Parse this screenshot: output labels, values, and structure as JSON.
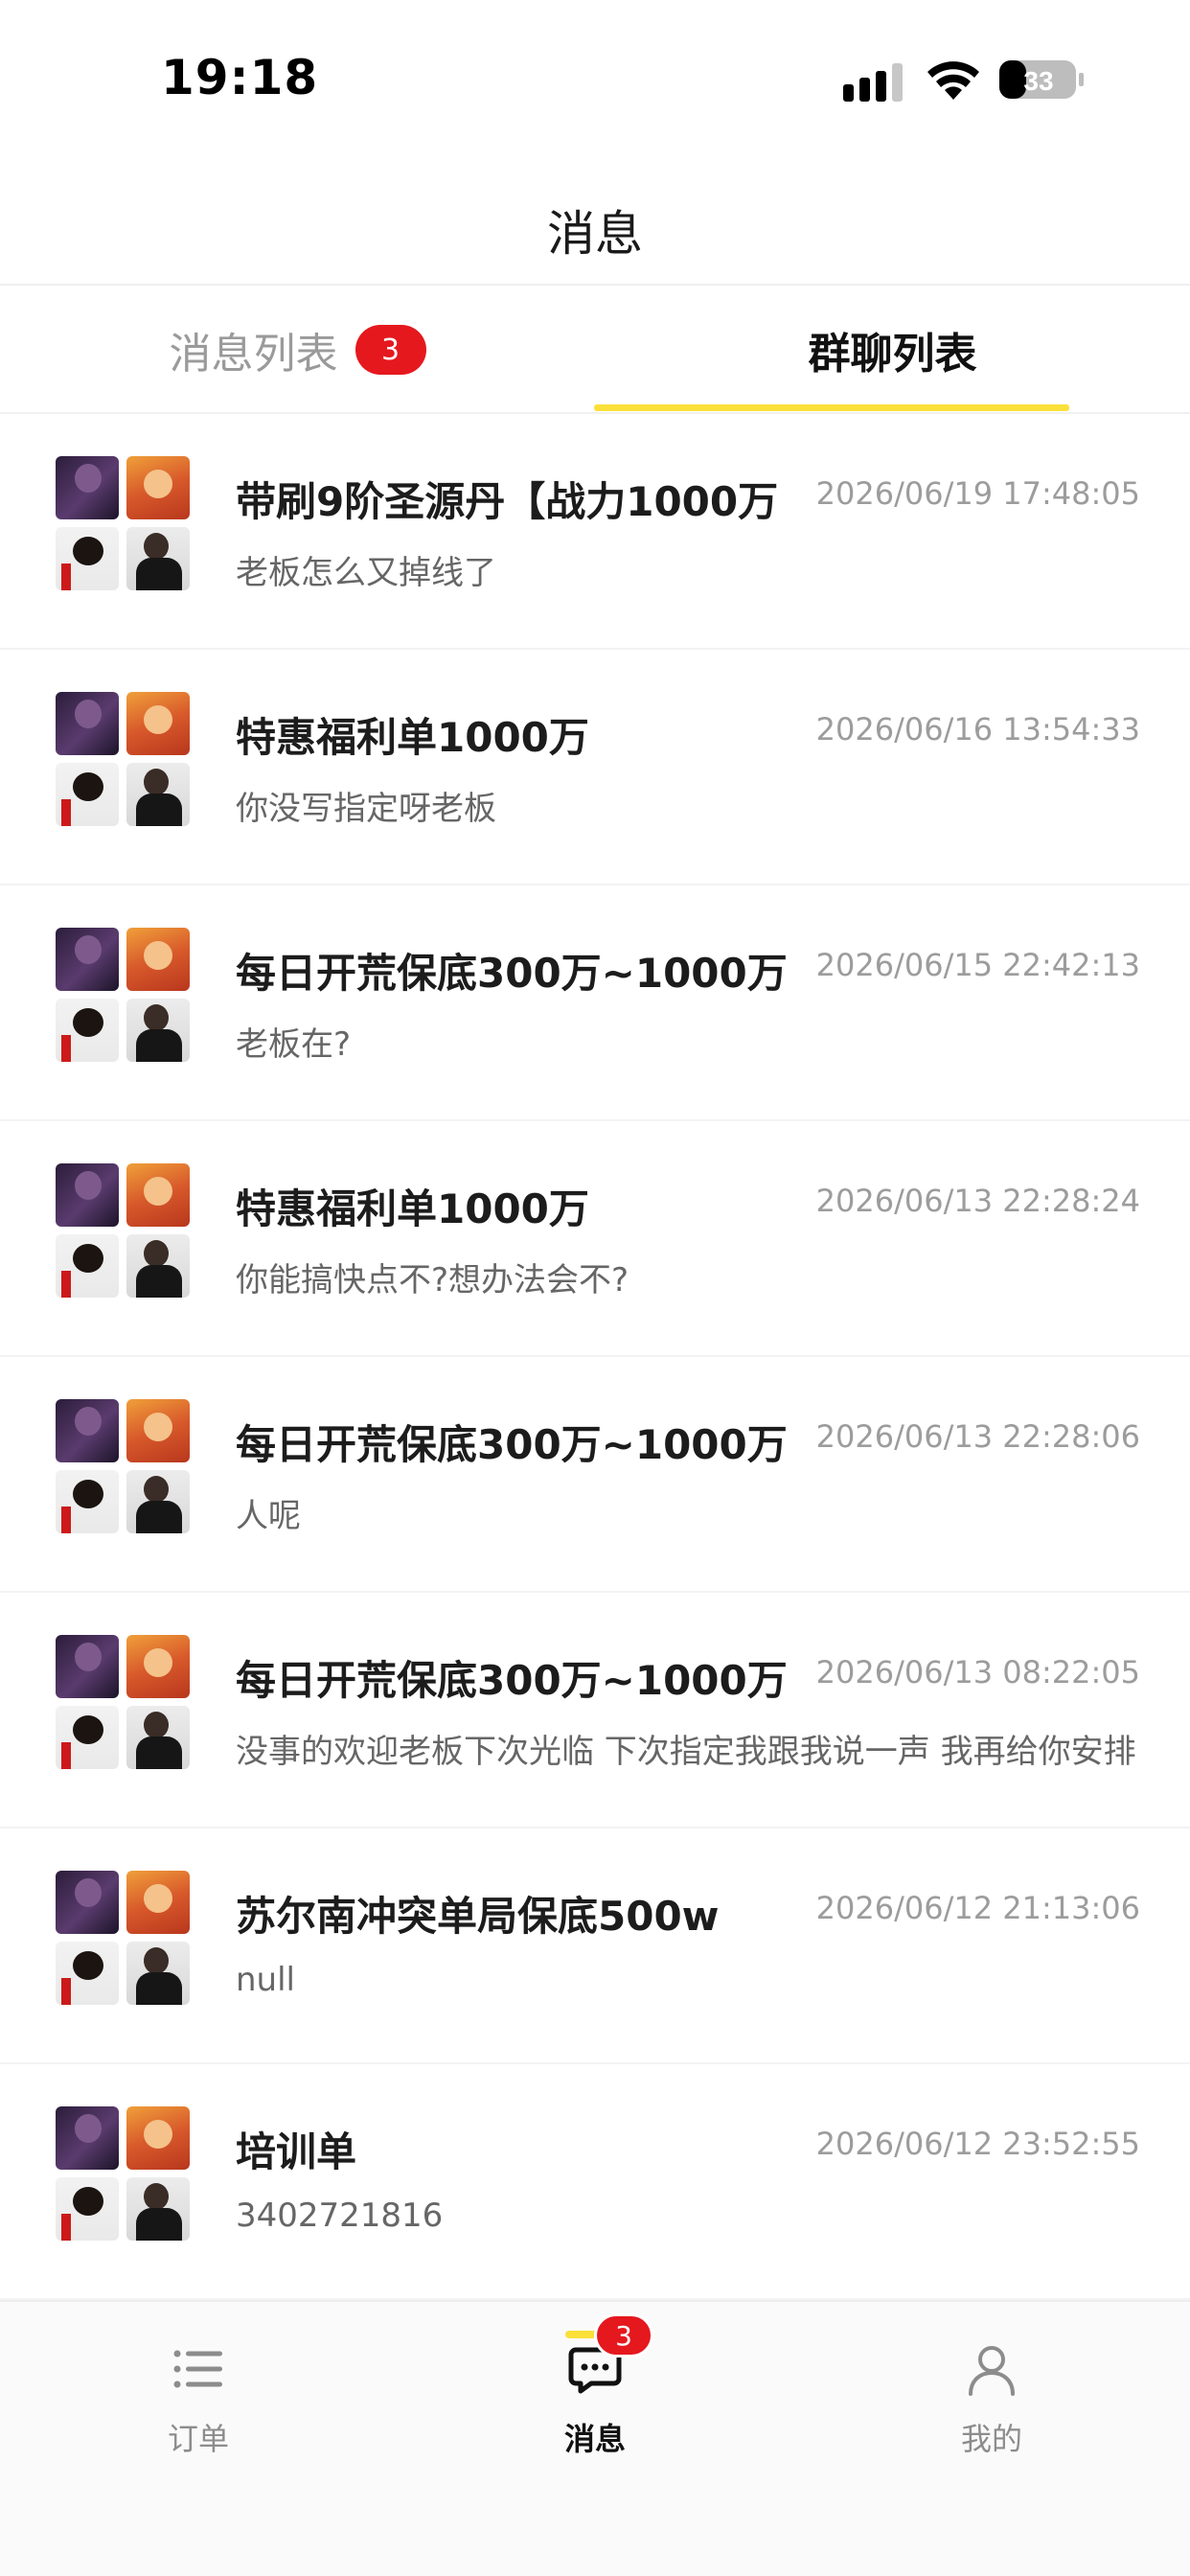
{
  "status_bar": {
    "time": "19:18",
    "battery": "33"
  },
  "header": {
    "title": "消息"
  },
  "tabs": [
    {
      "label": "消息列表",
      "badge": "3",
      "active": false
    },
    {
      "label": "群聊列表",
      "active": true
    }
  ],
  "colors": {
    "accent": "#fbe03a",
    "badge": "#e5181e"
  },
  "items": [
    {
      "title": "带刷9阶圣源丹【战力1000万",
      "time": "2026/06/19 17:48:05",
      "preview": "老板怎么又掉线了"
    },
    {
      "title": "特惠福利单1000万",
      "time": "2026/06/16 13:54:33",
      "preview": "你没写指定呀老板"
    },
    {
      "title": "每日开荒保底300万~1000万",
      "time": "2026/06/15 22:42:13",
      "preview": "老板在?"
    },
    {
      "title": "特惠福利单1000万",
      "time": "2026/06/13 22:28:24",
      "preview": "你能搞快点不?想办法会不?"
    },
    {
      "title": "每日开荒保底300万~1000万",
      "time": "2026/06/13 22:28:06",
      "preview": "人呢"
    },
    {
      "title": "每日开荒保底300万~1000万",
      "time": "2026/06/13 08:22:05",
      "preview": "没事的欢迎老板下次光临 下次指定我跟我说一声 我再给你安排"
    },
    {
      "title": "苏尔南冲突单局保底500w",
      "time": "2026/06/12 21:13:06",
      "preview": "null"
    },
    {
      "title": "培训单",
      "time": "2026/06/12 23:52:55",
      "preview": "3402721816"
    }
  ],
  "bottom_nav": [
    {
      "label": "订单",
      "icon": "list-icon"
    },
    {
      "label": "消息",
      "icon": "chat-icon",
      "badge": "3",
      "active": true
    },
    {
      "label": "我的",
      "icon": "user-icon"
    }
  ]
}
